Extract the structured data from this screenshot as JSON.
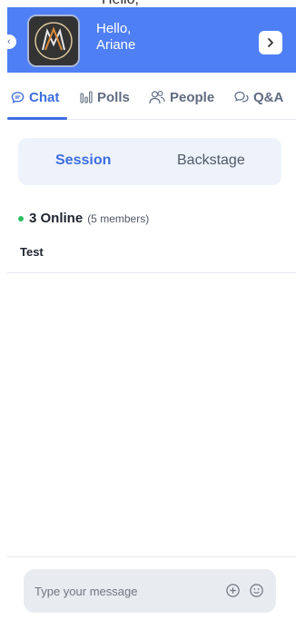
{
  "top": {
    "partial_text": "Hello,"
  },
  "user": {
    "greeting": "Hello,",
    "name": "Ariane"
  },
  "tabs": [
    {
      "label": "Chat",
      "icon": "chat-bubble-icon",
      "active": true
    },
    {
      "label": "Polls",
      "icon": "bar-chart-icon"
    },
    {
      "label": "People",
      "icon": "people-icon"
    },
    {
      "label": "Q&A",
      "icon": "qa-icon"
    }
  ],
  "segments": {
    "session": "Session",
    "backstage": "Backstage"
  },
  "online": {
    "count": "3 Online",
    "members": "(5 members)"
  },
  "chat_rows": [
    {
      "name": "Test"
    }
  ],
  "composer": {
    "placeholder": "Type your message",
    "add_icon": "plus-circle-icon",
    "emoji_icon": "smiley-icon"
  },
  "colors": {
    "header": "#4f7ff5",
    "accent": "#3d6de0",
    "online": "#2bbf62",
    "segment_bg": "#eef3fb",
    "composer_bg": "#e8ebf0"
  }
}
